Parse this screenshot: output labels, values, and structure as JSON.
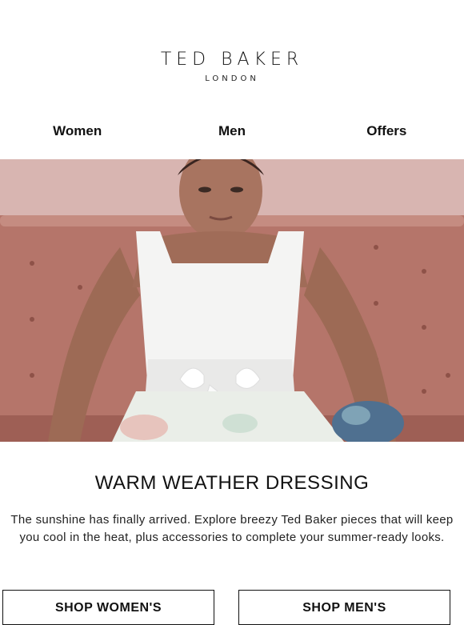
{
  "brand": {
    "name": "TED BAKER",
    "location": "LONDON"
  },
  "nav": {
    "items": [
      {
        "label": "Women"
      },
      {
        "label": "Men"
      },
      {
        "label": "Offers"
      }
    ]
  },
  "hero": {
    "image": "model-in-white-dress-on-pink-sofa"
  },
  "content": {
    "title": "WARM WEATHER DRESSING",
    "body": "The sunshine has finally arrived. Explore breezy Ted Baker pieces that will keep you cool in the heat, plus accessories to complete your summer-ready looks."
  },
  "buttons": {
    "shop_women": "SHOP WOMEN'S",
    "shop_men": "SHOP MEN'S"
  }
}
